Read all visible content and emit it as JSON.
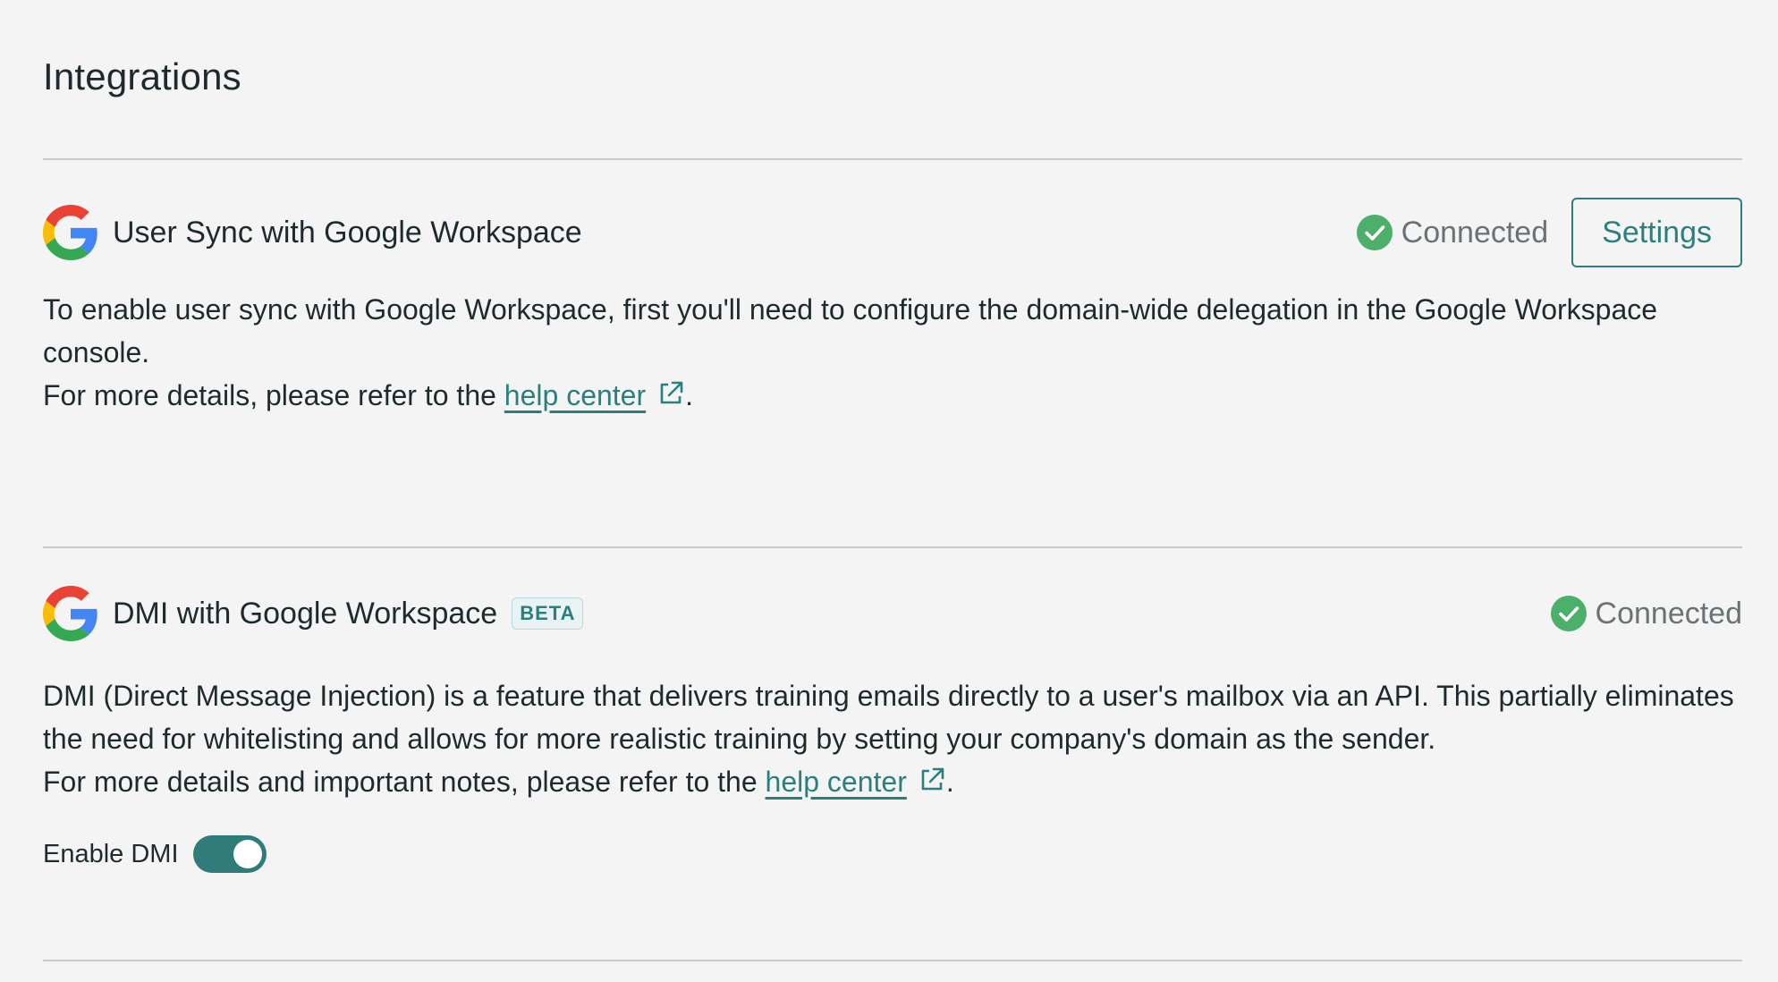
{
  "page": {
    "title": "Integrations"
  },
  "colors": {
    "background": "#f3f4f3",
    "accent": "#2d7f7d",
    "connected_green": "#4caf6a",
    "divider": "#c9cccc"
  },
  "integrations": [
    {
      "logo_icon": "google-logo-icon",
      "title": "User Sync with Google Workspace",
      "status_icon": "check-circle-icon",
      "status": "Connected",
      "settings_label": "Settings",
      "description_line1": "To enable user sync with Google Workspace, first you'll need to configure the domain-wide delegation in the Google Workspace console.",
      "description_line2_prefix": "For more details, please refer to the ",
      "link_text": "help center",
      "link_icon": "external-link-icon",
      "description_line2_suffix": "."
    },
    {
      "logo_icon": "google-logo-icon",
      "title": "DMI with Google Workspace",
      "badge": "BETA",
      "status_icon": "check-circle-icon",
      "status": "Connected",
      "description_line1": "DMI (Direct Message Injection) is a feature that delivers training emails directly to a user's mailbox via an API. This partially eliminates the need for whitelisting and allows for more realistic training by setting your company's domain as the sender.",
      "description_line2_prefix": "For more details and important notes, please refer to the ",
      "link_text": "help center",
      "link_icon": "external-link-icon",
      "description_line2_suffix": ".",
      "toggle_label": "Enable DMI",
      "toggle_on": true
    }
  ]
}
